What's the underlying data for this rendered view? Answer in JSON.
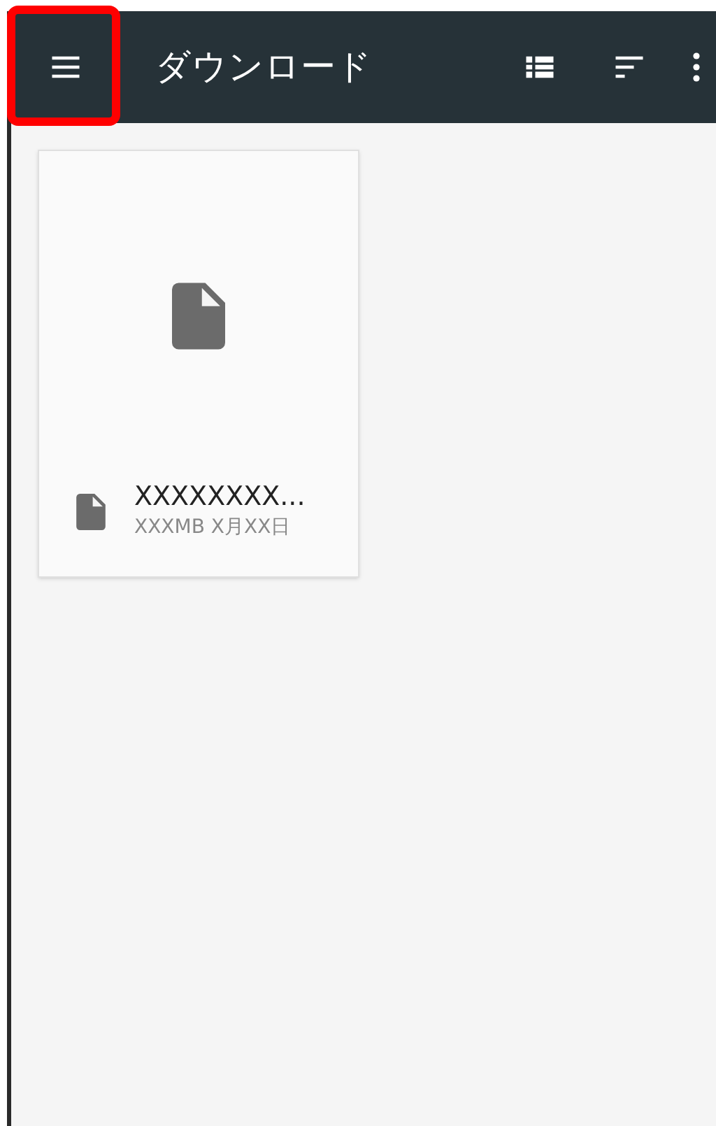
{
  "app_bar": {
    "title": "ダウンロード",
    "menu_highlighted": true
  },
  "files": [
    {
      "name": "XXXXXXXX...",
      "details": "XXXMB X月XX日"
    }
  ]
}
